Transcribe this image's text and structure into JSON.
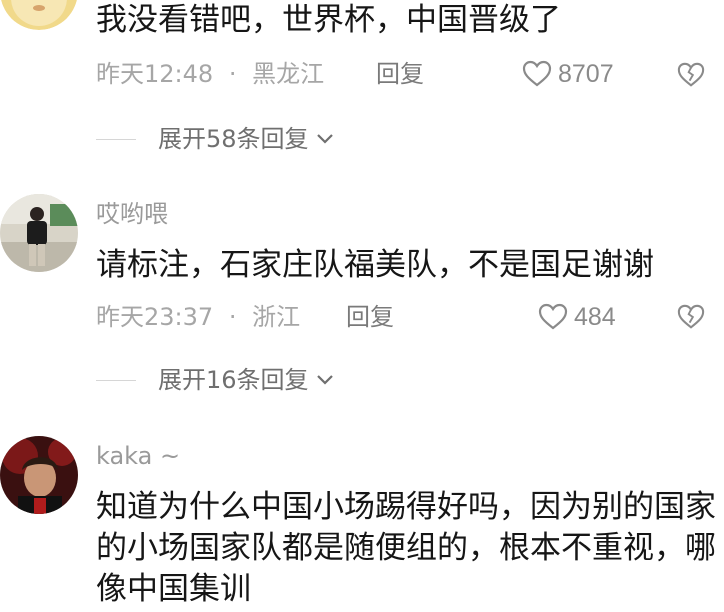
{
  "comments": [
    {
      "username": "",
      "text": "我没看错吧，世界杯，中国晋级了",
      "time": "昨天12:48",
      "sep": "·",
      "location": "黑龙江",
      "reply_label": "回复",
      "likes": "8707",
      "expand_label": "展开58条回复"
    },
    {
      "username": "哎哟喂",
      "text": "请标注，石家庄队福美队，不是国足谢谢",
      "time": "昨天23:37",
      "sep": "·",
      "location": "浙江",
      "reply_label": "回复",
      "likes": "484",
      "expand_label": "展开16条回复"
    },
    {
      "username": "kaka ~",
      "text": "知道为什么中国小场踢得好吗，因为别的国家的小场国家队都是随便组的，根本不重视，哪像中国集训"
    }
  ],
  "icons": {
    "like": "heart-outline-icon",
    "dislike": "broken-heart-icon",
    "expand": "chevron-down-icon"
  },
  "colors": {
    "text": "#161616",
    "meta": "#a6a6a6",
    "icon": "#8a8a8a",
    "background": "#ffffff"
  }
}
